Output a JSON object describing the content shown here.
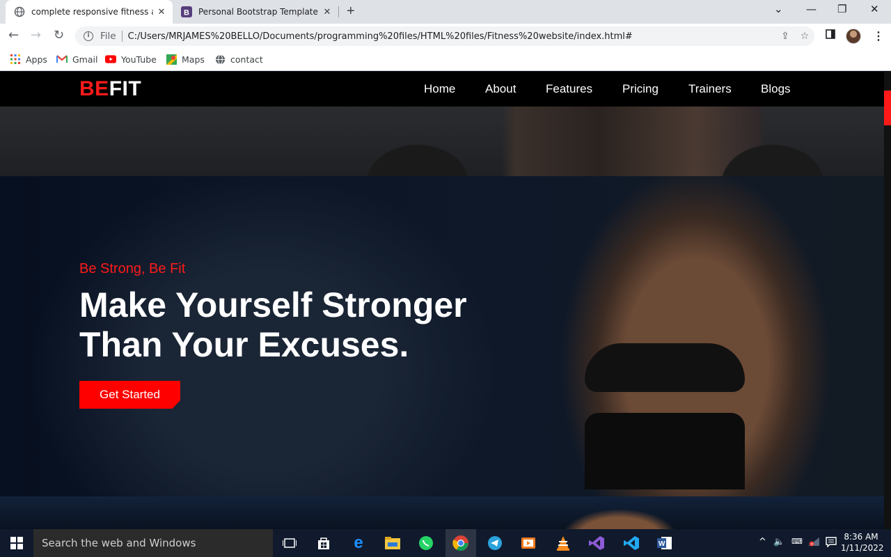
{
  "browser": {
    "tabs": [
      {
        "title": "complete responsive fitness and",
        "close": "✕"
      },
      {
        "title": "Personal Bootstrap Template",
        "close": "✕"
      }
    ],
    "new_tab": "+",
    "window_controls": {
      "chevron": "⌄",
      "minimize": "—",
      "restore": "❐",
      "close": "✕"
    },
    "nav": {
      "back": "←",
      "forward": "→",
      "reload": "↻"
    },
    "address": {
      "scheme": "File",
      "url": "C:/Users/MRJAMES%20BELLO/Documents/programming%20files/HTML%20files/Fitness%20website/index.html#"
    },
    "bookmarks": [
      {
        "label": "Apps"
      },
      {
        "label": "Gmail"
      },
      {
        "label": "YouTube"
      },
      {
        "label": "Maps"
      },
      {
        "label": "contact"
      }
    ]
  },
  "site": {
    "logo": {
      "accent": "BE",
      "rest": "FIT"
    },
    "menu": [
      "Home",
      "About",
      "Features",
      "Pricing",
      "Trainers",
      "Blogs"
    ],
    "hero": {
      "tagline": "Be Strong, Be Fit",
      "headline_line1": "Make Yourself Stronger",
      "headline_line2": "Than Your Excuses.",
      "cta": "Get Started"
    },
    "colors": {
      "accent": "#ff1a1a",
      "nav_bg": "#000000"
    }
  },
  "taskbar": {
    "search_placeholder": "Search the web and Windows",
    "time": "8:36 AM",
    "date": "1/11/2022",
    "apps": [
      "task-view",
      "store",
      "edge",
      "file-explorer",
      "whatsapp",
      "chrome",
      "telegram",
      "media-player",
      "vlc",
      "visual-studio",
      "vscode",
      "word"
    ]
  }
}
